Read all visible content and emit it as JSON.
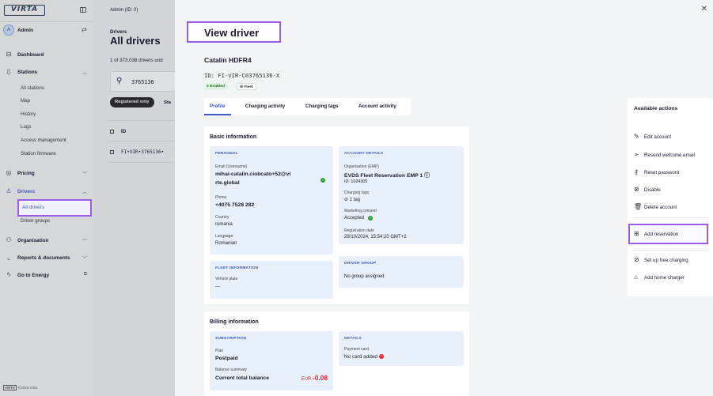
{
  "sidebar": {
    "logo": "VIRTA",
    "user": "Admin",
    "avatar_initials": "A",
    "nav": {
      "dashboard": "Dashboard",
      "stations": "Stations",
      "stations_sub": [
        "All stations",
        "Map",
        "History",
        "Logs",
        "Access management",
        "Station firmware"
      ],
      "pricing": "Pricing",
      "drivers": "Drivers",
      "drivers_sub_active": "All drivers",
      "drivers_sub": [
        "Driver groups"
      ],
      "organisation": "Organisation",
      "reports": "Reports & documents",
      "energy": "Go to Energy"
    },
    "footer_logo": "VIRTA",
    "footer_text": "©2025 Virta"
  },
  "list": {
    "crumb": "Admin (ID: 0)",
    "parent": "Drivers",
    "title": "All drivers",
    "count": "1 of 373,038 drivers und",
    "search_value": "3765136",
    "filter_active": "Registered only",
    "filter_other": "Sta",
    "column_id": "ID",
    "row_id": "FI•VIR•3765136•"
  },
  "drawer": {
    "title": "View driver",
    "name": "Catalin HDFR4",
    "id_text": "ID: FI-VIR-C03765136-X",
    "badge_enabled": "● Enabled",
    "badge_fleet": "⊜ Fleet",
    "tabs": [
      "Profile",
      "Charging activity",
      "Charging tags",
      "Account activity"
    ],
    "basic": {
      "title": "Basic information",
      "personal": {
        "heading": "PERSONAL",
        "email_label": "Email (Username)",
        "email_line1": "mihai-catalin.ciobcato+52@vi",
        "email_line2": "rte.global",
        "phone_label": "Phone",
        "phone": "+4075 7528 282",
        "country_label": "Country",
        "country": "romania",
        "language_label": "Language",
        "language": "Romanian"
      },
      "account": {
        "heading": "ACCOUNT DETAILS",
        "org_label": "Organisation (EMP)",
        "org": "EVDS Fleet Reservation EMP 1 ⓘ",
        "org_id": "ID: 1024305",
        "tags_label": "Charging tags",
        "tags": "⊘ 1 tag",
        "marketing_label": "Marketing consent",
        "marketing": "Accepted",
        "reg_label": "Registration date",
        "reg": "29/10/2024, 15:54:20 GMT+2"
      },
      "fleet": {
        "heading": "FLEET INFORMATION",
        "plate_label": "Vehicle plate",
        "plate": "—"
      },
      "group": {
        "heading": "DRIVER GROUP",
        "value": "No group assigned"
      }
    },
    "billing": {
      "title": "Billing information",
      "subscription": {
        "heading": "SUBSCRIPTION",
        "plan_label": "Plan",
        "plan": "Postpaid",
        "balance_label": "Balance summary",
        "balance_title": "Current total balance",
        "currency": "EUR",
        "amount": "-0.08"
      },
      "details": {
        "heading": "DETAILS",
        "card_label": "Payment card",
        "card": "No card added"
      }
    },
    "actions": {
      "title": "Available actions",
      "edit": "Edit account",
      "resend": "Resend welcome email",
      "reset": "Reset password",
      "disable": "Disable",
      "delete": "Delete account",
      "reservation": "Add reservation",
      "free": "Set up free charging",
      "home": "Add home charger"
    }
  },
  "colors": {
    "accent": "#3d57c6",
    "highlight": "#9b5de5",
    "negative": "#e0262f",
    "positive": "#2e9e3d"
  }
}
